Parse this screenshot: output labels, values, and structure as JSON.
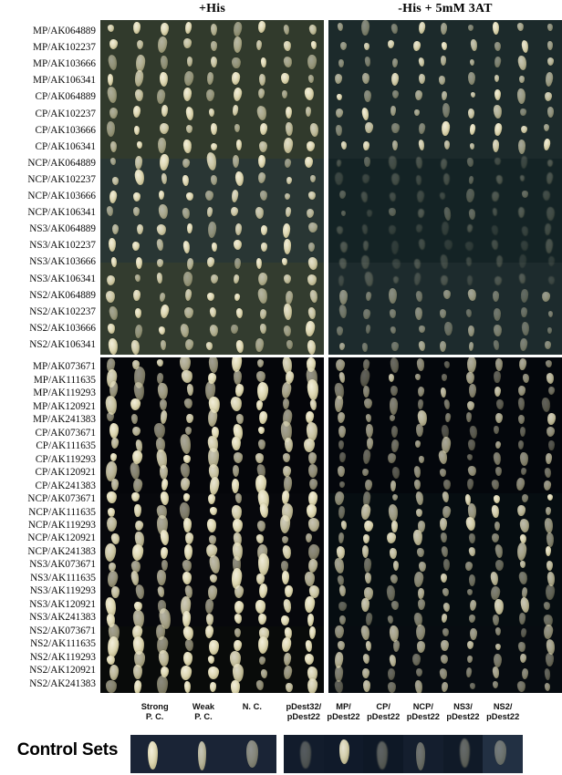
{
  "figure": {
    "headers": {
      "left_plate": "+His",
      "right_plate": "-His + 5mM 3AT"
    },
    "control_section_label": "Control Sets",
    "colony_columns": 9
  },
  "blocks": [
    {
      "id": "upper",
      "agar_color": "#313a2c",
      "agar_color_right": "#1c2a2b",
      "row_labels": [
        "MP/AK064889",
        "MP/AK102237",
        "MP/AK103666",
        "MP/AK106341",
        "CP/AK064889",
        "CP/AK102237",
        "CP/AK103666",
        "CP/AK106341",
        "NCP/AK064889",
        "NCP/AK102237",
        "NCP/AK103666",
        "NCP/AK106341",
        "NS3/AK064889",
        "NS3/AK102237",
        "NS3/AK103666",
        "NS3/AK106341",
        "NS2/AK064889",
        "NS2/AK102237",
        "NS2/AK103666",
        "NS2/AK106341"
      ]
    },
    {
      "id": "lower",
      "agar_color": "#05060a",
      "agar_color_right": "#04070c",
      "row_labels": [
        "MP/AK073671",
        "MP/AK111635",
        "MP/AK119293",
        "MP/AK120921",
        "MP/AK241383",
        "CP/AK073671",
        "CP/AK111635",
        "CP/AK119293",
        "CP/AK120921",
        "CP/AK241383",
        "NCP/AK073671",
        "NCP/AK111635",
        "NCP/AK119293",
        "NCP/AK120921",
        "NCP/AK241383",
        "NS3/AK073671",
        "NS3/AK111635",
        "NS3/AK119293",
        "NS3/AK120921",
        "NS3/AK241383",
        "NS2/AK073671",
        "NS2/AK111635",
        "NS2/AK119293",
        "NS2/AK120921",
        "NS2/AK241383"
      ]
    }
  ],
  "controls": {
    "left_plate_labels": [
      "Strong\nP. C.",
      "Weak\nP. C.",
      "N. C."
    ],
    "right_plate_labels": [
      "pDest32/\npDest22",
      "MP/\npDest22",
      "CP/\npDest22",
      "NCP/\npDest22",
      "NS3/\npDest22",
      "NS2/\npDest22"
    ]
  }
}
